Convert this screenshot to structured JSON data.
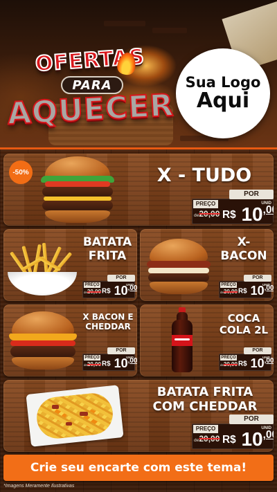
{
  "hero": {
    "title_line1": "OFERTAS",
    "title_line2": "PARA",
    "title_line3": "AQUECER",
    "logo_line1": "Sua Logo",
    "logo_line2": "Aqui"
  },
  "products": [
    {
      "name": "X - TUDO",
      "badge": "-50%",
      "por": "POR",
      "preco": "PREÇO",
      "old_prefix": "de",
      "old_price": "20,00",
      "currency": "R$",
      "price_int": "10",
      "price_cents": ",00",
      "unit": "UNID"
    },
    {
      "name": "BATATA FRITA",
      "por": "POR",
      "preco": "PREÇO",
      "old_prefix": "de",
      "old_price": "20,00",
      "currency": "R$",
      "price_int": "10",
      "price_cents": ",00",
      "unit": "UNID"
    },
    {
      "name": "X-BACON",
      "por": "POR",
      "preco": "PREÇO",
      "old_prefix": "de",
      "old_price": "20,00",
      "currency": "R$",
      "price_int": "10",
      "price_cents": ",00",
      "unit": "UNID"
    },
    {
      "name": "X BACON E CHEDDAR",
      "por": "POR",
      "preco": "PREÇO",
      "old_prefix": "de",
      "old_price": "20,00",
      "currency": "R$",
      "price_int": "10",
      "price_cents": ",00",
      "unit": "UNID"
    },
    {
      "name": "COCA COLA 2L",
      "por": "POR",
      "preco": "PREÇO",
      "old_prefix": "de",
      "old_price": "20,00",
      "currency": "R$",
      "price_int": "10",
      "price_cents": ",00",
      "unit": "UNID"
    },
    {
      "name": "BATATA FRITA COM CHEDDAR",
      "por": "POR",
      "preco": "PREÇO",
      "old_prefix": "de",
      "old_price": "20,00",
      "currency": "R$",
      "price_int": "10",
      "price_cents": ",00",
      "unit": "UNID"
    }
  ],
  "cta_label": "Crie seu encarte com este tema!",
  "disclaimer": "*Imagens Meramente Ilustrativas",
  "colors": {
    "accent": "#f26e17",
    "title_red": "#d8161b",
    "wood": "#7a3f1a"
  }
}
